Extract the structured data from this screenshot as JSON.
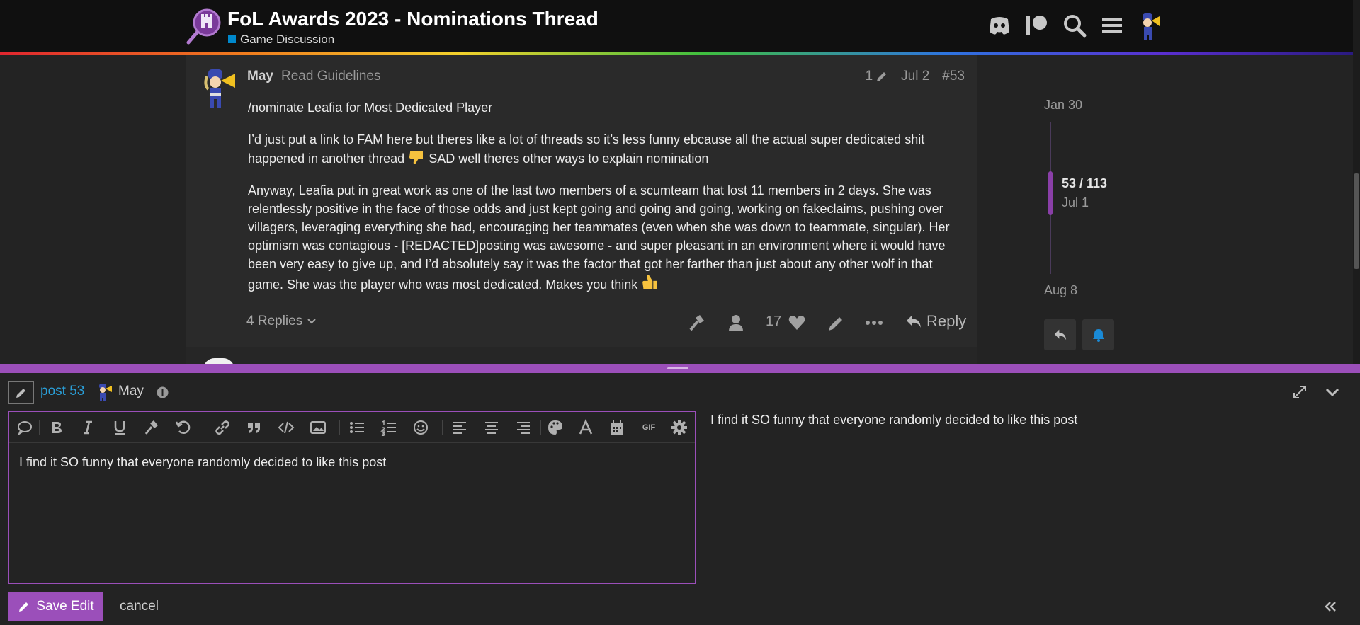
{
  "header": {
    "title": "FoL Awards 2023 - Nominations Thread",
    "category": "Game Discussion",
    "icons": [
      "discord-icon",
      "patreon-icon",
      "search-icon",
      "hamburger-menu-icon",
      "user-avatar"
    ]
  },
  "post": {
    "username": "May",
    "user_title": "Read Guidelines",
    "edit_count": "1",
    "date": "Jul 2",
    "post_number": "#53",
    "paragraphs": {
      "p1": "/nominate Leafia for Most Dedicated Player",
      "p2a": "I’d just put a link to FAM here but theres like a lot of threads so it’s less funny ebcause all the actual super dedicated shit happened in another thread ",
      "p2b": " SAD well theres other ways to explain nomination",
      "p3": "Anyway, Leafia put in great work as one of the last two members of a scumteam that lost 11 members in 2 days. She was relentlessly positive in the face of those odds and just kept going and going and going, working on fakeclaims, pushing over villagers, leveraging everything she had, encouraging her teammates (even when she was down to teammate, singular). Her optimism was contagious - [REDACTED]posting was awesome - and super pleasant in an environment where it would have been very easy to give up, and I’d absolutely say it was the factor that got her farther than just about any other wolf in that game. She was the player who was most dedicated. Makes you think "
    },
    "replies_label": "4 Replies",
    "like_count": "17",
    "reply_label": "Reply"
  },
  "timeline": {
    "start": "Jan 30",
    "position": "53 / 113",
    "current_date": "Jul 1",
    "end": "Aug 8"
  },
  "composer": {
    "post_link": "post 53",
    "user_name": "May",
    "editor_text": "I find it SO funny that everyone randomly decided to like this post",
    "preview_text": "I find it SO funny that everyone randomly decided to like this post",
    "save_label": "Save Edit",
    "cancel_label": "cancel",
    "toolbar": [
      "chat-bubble-icon",
      "bold-icon",
      "italic-icon",
      "underline-icon",
      "hammer-icon",
      "undo-icon",
      "link-icon",
      "quote-icon",
      "code-icon",
      "image-icon",
      "bullet-list-icon",
      "numbered-list-icon",
      "emoji-icon",
      "align-left-icon",
      "align-center-icon",
      "align-right-icon",
      "palette-icon",
      "font-icon",
      "calendar-icon",
      "gif-icon",
      "gear-icon"
    ],
    "gif_label": "GIF"
  },
  "colors": {
    "accent": "#9b4fba",
    "link": "#2a9fd8",
    "background": "#232323"
  }
}
